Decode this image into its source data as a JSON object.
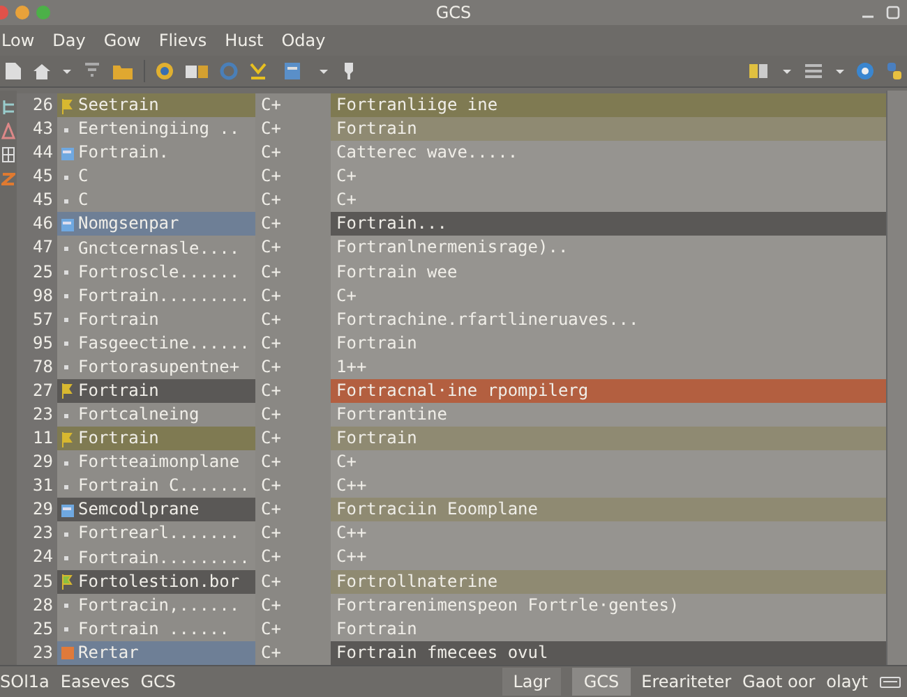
{
  "window": {
    "title": "GCS"
  },
  "menu": [
    "Low",
    "Day",
    "Gow",
    "Flievs",
    "Hust",
    "Oday"
  ],
  "rows": [
    {
      "num": "26",
      "type": "C+",
      "name": {
        "kind": "flag",
        "text": "Seetrain",
        "color": "#7f7a52"
      },
      "desc": {
        "text": "Fortranliige ine",
        "color": "#7f7a52"
      }
    },
    {
      "num": "43",
      "type": "C+",
      "name": {
        "kind": "bullet",
        "text": "Eerteningiing .."
      },
      "desc": {
        "text": "Fortrain",
        "color": "#8f8a72"
      }
    },
    {
      "num": "44",
      "type": "C+",
      "name": {
        "kind": "doc",
        "text": "Fortrain."
      },
      "desc": {
        "text": "Catterec wave....."
      }
    },
    {
      "num": "45",
      "type": "C+",
      "name": {
        "kind": "bullet",
        "text": "C"
      },
      "desc": {
        "text": "C+"
      }
    },
    {
      "num": "45",
      "type": "C+",
      "name": {
        "kind": "bullet",
        "text": "C"
      },
      "desc": {
        "text": "C+"
      }
    },
    {
      "num": "46",
      "type": "C+",
      "name": {
        "kind": "doc",
        "text": "Nomgsenpar",
        "color": "#6e7f96"
      },
      "desc": {
        "text": "Fortrain...",
        "color": "#5a5856"
      }
    },
    {
      "num": "47",
      "type": "C+",
      "name": {
        "kind": "bullet",
        "text": "Gnctcernasle...."
      },
      "desc": {
        "text": "Fortranlnermenisrage).."
      }
    },
    {
      "num": "25",
      "type": "C+",
      "name": {
        "kind": "bullet",
        "text": "Fortroscle......"
      },
      "desc": {
        "text": "Fortrain wee"
      }
    },
    {
      "num": "98",
      "type": "C+",
      "name": {
        "kind": "bullet",
        "text": "Fortrain........."
      },
      "desc": {
        "text": "C+"
      }
    },
    {
      "num": "57",
      "type": "C+",
      "name": {
        "kind": "bullet",
        "text": "Fortrain"
      },
      "desc": {
        "text": "Fortrachine.rfartlineruaves..."
      }
    },
    {
      "num": "95",
      "type": "C+",
      "name": {
        "kind": "bullet",
        "text": "Fasgeectine......"
      },
      "desc": {
        "text": "Fortrain"
      }
    },
    {
      "num": "78",
      "type": "C+",
      "name": {
        "kind": "bullet",
        "text": "Fortorasupentne+"
      },
      "desc": {
        "text": "1++"
      }
    },
    {
      "num": "27",
      "type": "C+",
      "name": {
        "kind": "flag",
        "text": "Fortrain",
        "color": "#5a5856"
      },
      "desc": {
        "text": "Fortracnal·ine rpompilerg",
        "color": "#b35f40"
      }
    },
    {
      "num": "23",
      "type": "C+",
      "name": {
        "kind": "bullet",
        "text": "Fortcalneing"
      },
      "desc": {
        "text": "Fortrantine"
      }
    },
    {
      "num": "11",
      "type": "C+",
      "name": {
        "kind": "flag",
        "text": "Fortrain",
        "color": "#7f7a52"
      },
      "desc": {
        "text": "Fortrain",
        "color": "#8f8a72"
      }
    },
    {
      "num": "29",
      "type": "C+",
      "name": {
        "kind": "bullet",
        "text": "Fortteaimonplane"
      },
      "desc": {
        "text": "C+"
      }
    },
    {
      "num": "31",
      "type": "C+",
      "name": {
        "kind": "bullet",
        "text": "Fortrain C......."
      },
      "desc": {
        "text": "C++"
      }
    },
    {
      "num": "29",
      "type": "C+",
      "name": {
        "kind": "doc",
        "text": "Semcodlprane",
        "color": "#5a5856"
      },
      "desc": {
        "text": "Fortraciin Eoomplane",
        "color": "#8f8a72"
      }
    },
    {
      "num": "23",
      "type": "C+",
      "name": {
        "kind": "bullet",
        "text": "Fortrearl......."
      },
      "desc": {
        "text": "C++"
      }
    },
    {
      "num": "24",
      "type": "C+",
      "name": {
        "kind": "bullet",
        "text": "Fortrain........."
      },
      "desc": {
        "text": "C++"
      }
    },
    {
      "num": "25",
      "type": "C+",
      "name": {
        "kind": "greenflag",
        "text": "Fortolestion.bor",
        "color": "#5a5856"
      },
      "desc": {
        "text": "Fortrollnaterine",
        "color": "#8f8a72"
      }
    },
    {
      "num": "28",
      "type": "C+",
      "name": {
        "kind": "bullet",
        "text": "Fortracin,......"
      },
      "desc": {
        "text": "Fortrarenimenspeon Fortrle·gentes)"
      }
    },
    {
      "num": "25",
      "type": "C+",
      "name": {
        "kind": "bullet",
        "text": "Fortrain ......"
      },
      "desc": {
        "text": "Fortrain"
      }
    },
    {
      "num": "23",
      "type": "C+",
      "name": {
        "kind": "square",
        "text": "Rertar",
        "color": "#6e7f96"
      },
      "desc": {
        "text": "Fortrain fmecees ovul",
        "color": "#5a5856"
      }
    }
  ],
  "status_bar": {
    "left": [
      "SOl1a",
      "Easeves",
      "GCS"
    ],
    "tabs": [
      {
        "label": "Lagr",
        "selected": false
      },
      {
        "label": "GCS",
        "selected": true
      }
    ],
    "right": [
      "Ereariteter",
      "Gaot oor",
      "olayt"
    ]
  }
}
